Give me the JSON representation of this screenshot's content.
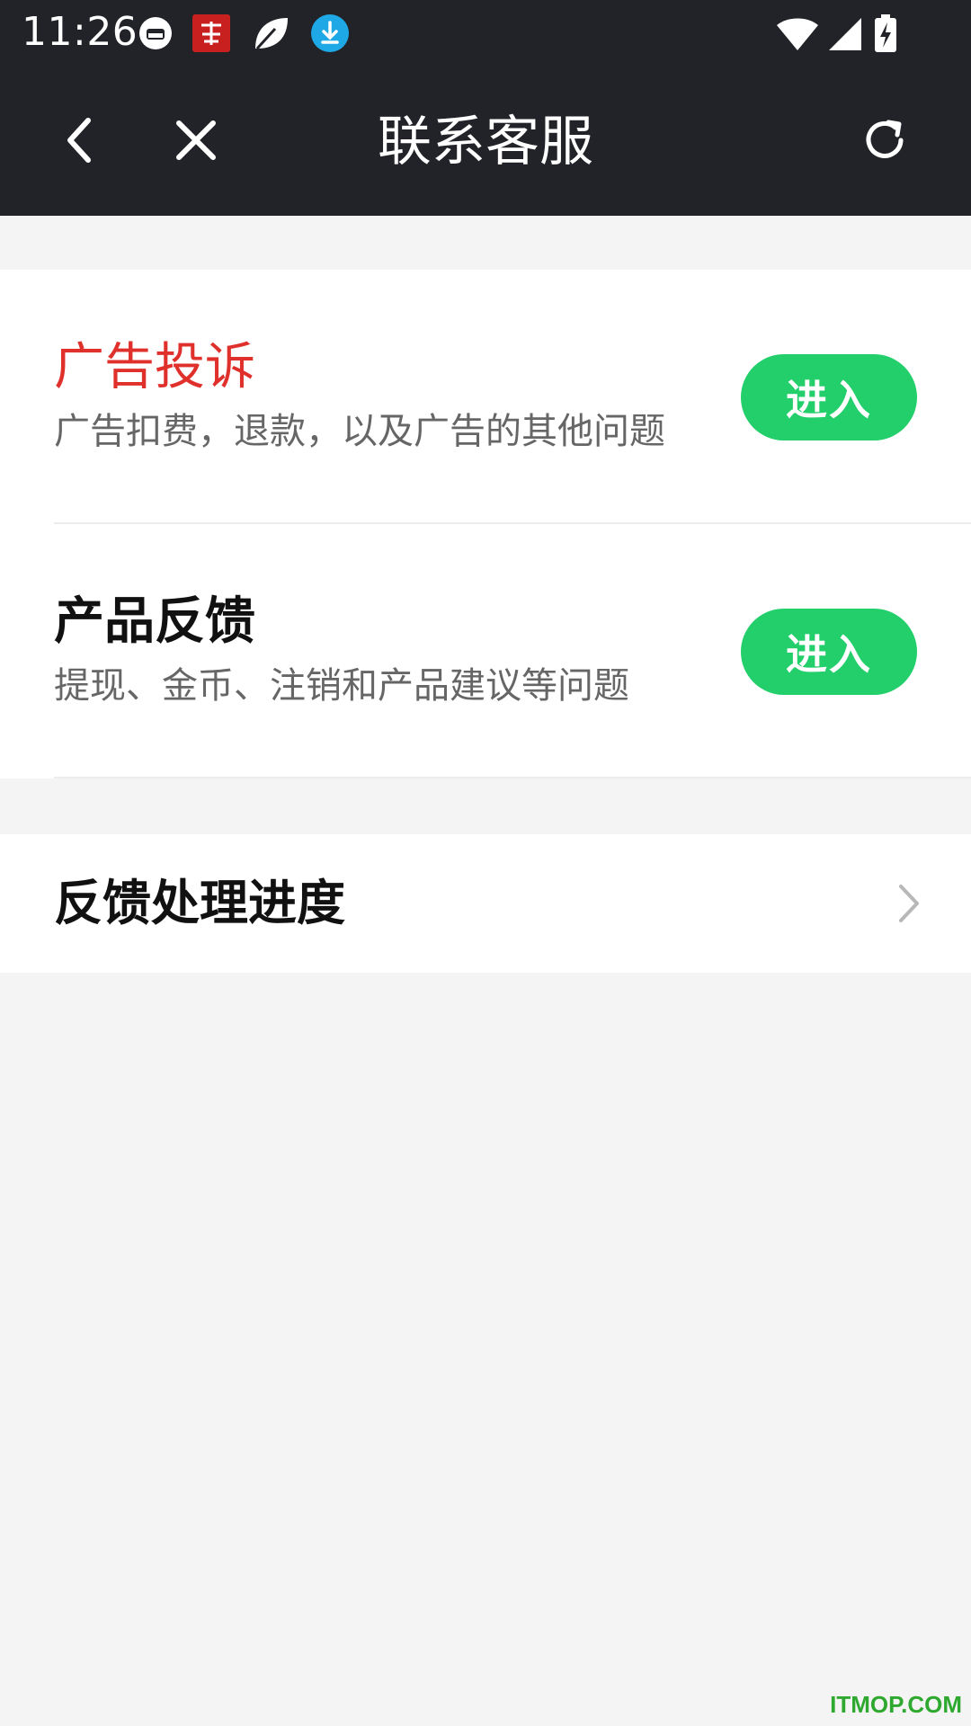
{
  "status_bar": {
    "time": "11:26",
    "notification_icons": [
      "vpn-icon",
      "app-icon",
      "leaf-icon",
      "download-icon"
    ],
    "system_icons": [
      "wifi-icon",
      "signal-icon",
      "battery-charging-icon"
    ]
  },
  "header": {
    "title": "联系客服",
    "back_icon": "chevron-left-icon",
    "close_icon": "close-icon",
    "refresh_icon": "refresh-icon"
  },
  "services": [
    {
      "title": "广告投诉",
      "description": "广告扣费，退款，以及广告的其他问题",
      "button_label": "进入",
      "title_color": "#e0302c"
    },
    {
      "title": "产品反馈",
      "description": "提现、金币、注销和产品建议等问题",
      "button_label": "进入",
      "title_color": "#111111"
    }
  ],
  "progress": {
    "label": "反馈处理进度",
    "icon": "chevron-right-icon"
  },
  "colors": {
    "header_bg": "#222329",
    "accent_green": "#22cf6a",
    "alert_red": "#e0302c",
    "page_bg": "#f4f4f4"
  },
  "watermark": "ITMOP.COM"
}
